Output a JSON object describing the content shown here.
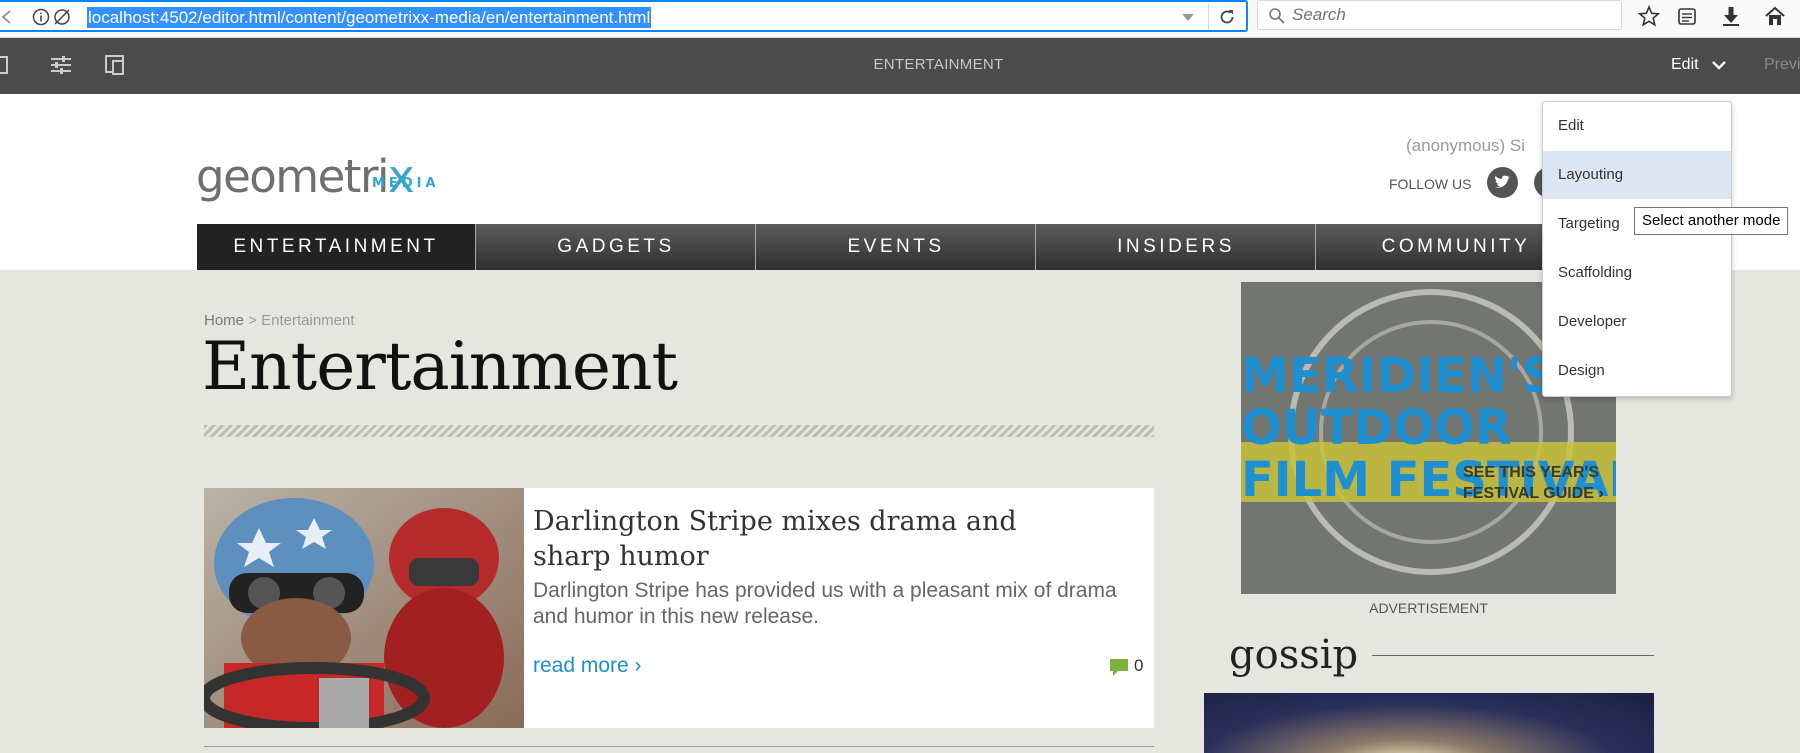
{
  "browser": {
    "url": "localhost:4502/editor.html/content/geometrixx-media/en/entertainment.html",
    "search_placeholder": "Search"
  },
  "editor": {
    "page_title": "ENTERTAINMENT",
    "mode_label": "Edit",
    "preview_label": "Previe"
  },
  "header": {
    "logo_text_main": "geometri",
    "logo_text_x": "x",
    "logo_text_media": "MEDIA",
    "user_label": "(anonymous)   Si",
    "follow_label": "FOLLOW US"
  },
  "nav": {
    "items": [
      "ENTERTAINMENT",
      "GADGETS",
      "EVENTS",
      "INSIDERS",
      "COMMUNITY"
    ]
  },
  "content": {
    "breadcrumb_home": "Home",
    "breadcrumb_sep": " > ",
    "breadcrumb_current": "Entertainment",
    "title": "Entertainment",
    "article": {
      "title": "Darlington Stripe mixes drama and sharp humor",
      "description": "Darlington Stripe has provided us with a pleasant mix of drama and humor in this new release.",
      "read_more": "read more ›",
      "comment_count": "0"
    },
    "ad": {
      "line1": "MERIDIEN'S",
      "line2": "OUTDOOR",
      "line3": "FILM FESTIVAL",
      "cta1": "SEE THIS YEAR'S",
      "cta2": "FESTIVAL GUIDE ›",
      "label": "ADVERTISEMENT"
    },
    "gossip_heading": "gossip"
  },
  "mode_menu": {
    "items": [
      "Edit",
      "Layouting",
      "Targeting",
      "Scaffolding",
      "Developer",
      "Design"
    ],
    "highlighted": "Layouting",
    "tooltip": "Select another mode"
  },
  "colors": {
    "accent": "#35a5cf",
    "link": "#1f8ec7",
    "editor_bar": "#4b4b4b",
    "content_bg": "#e6e6e0",
    "url_selection": "#3390ff"
  }
}
